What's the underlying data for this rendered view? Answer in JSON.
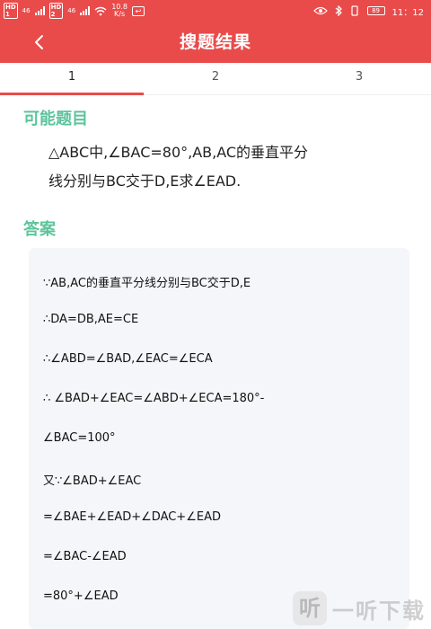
{
  "status_bar": {
    "net_a": "46",
    "net_b": "46",
    "speed_value": "10.8",
    "speed_unit": "K/s",
    "battery": "89",
    "time": "11：12"
  },
  "header": {
    "title": "搜题结果",
    "back_icon": "chevron-left-icon"
  },
  "tabs": [
    {
      "label": "1",
      "active": true
    },
    {
      "label": "2",
      "active": false
    },
    {
      "label": "3",
      "active": false
    }
  ],
  "question": {
    "heading": "可能题目",
    "lines": [
      "△ABC中,∠BAC=80°,AB,AC的垂直平分",
      "线分别与BC交于D,E求∠EAD."
    ]
  },
  "answer": {
    "heading": "答案",
    "lines": [
      "∵AB,AC的垂直平分线分别与BC交于D,E",
      "∴DA=DB,AE=CE",
      "∴∠ABD=∠BAD,∠EAC=∠ECA",
      "∴ ∠BAD+∠EAC=∠ABD+∠ECA=180°-",
      "∠BAC=100°",
      "又∵∠BAD+∠EAC",
      "=∠BAE+∠EAD+∠DAC+∠EAD",
      "=∠BAC-∠EAD",
      "=80°+∠EAD"
    ]
  },
  "watermark": {
    "logo": "听",
    "text": "一听下载"
  },
  "colors": {
    "brand_red": "#e94b4b",
    "heading_green": "#5cc49a"
  }
}
